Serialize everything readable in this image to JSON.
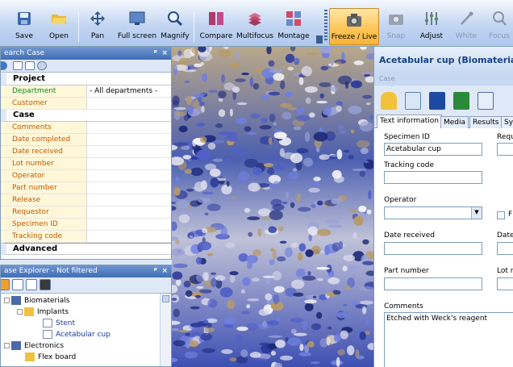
{
  "toolbar": {
    "save": "Save",
    "open": "Open",
    "pan": "Pan",
    "fullscreen": "Full screen",
    "magnify": "Magnify",
    "compare": "Compare",
    "multifocus": "Multifocus",
    "montage": "Montage",
    "freeze_live": "Freeze / Live",
    "snap": "Snap",
    "adjust": "Adjust",
    "white": "White",
    "focus": "Focus"
  },
  "search_panel": {
    "title": "earch Case",
    "pin": "⁵",
    "close": "×",
    "sections": {
      "project": "Project",
      "case": "Case",
      "advanced": "Advanced"
    },
    "project_rows": [
      {
        "key": "Department",
        "value": "- All departments -"
      },
      {
        "key": "Customer",
        "value": ""
      }
    ],
    "case_rows": [
      {
        "key": "Comments",
        "value": ""
      },
      {
        "key": "Date completed",
        "value": ""
      },
      {
        "key": "Date received",
        "value": ""
      },
      {
        "key": "Lot number",
        "value": ""
      },
      {
        "key": "Operator",
        "value": ""
      },
      {
        "key": "Part number",
        "value": ""
      },
      {
        "key": "Release",
        "value": ""
      },
      {
        "key": "Requestor",
        "value": ""
      },
      {
        "key": "Specimen ID",
        "value": ""
      },
      {
        "key": "Tracking code",
        "value": ""
      }
    ]
  },
  "explorer_panel": {
    "title": "ase Explorer - Not filtered",
    "pin": "⁵",
    "close": "×",
    "items": [
      {
        "label": "Biomaterials"
      },
      {
        "label": "Implants"
      },
      {
        "label": "Stent"
      },
      {
        "label": "Acetabular cup"
      },
      {
        "label": "Electronics"
      },
      {
        "label": "Flex board"
      }
    ]
  },
  "detail_panel": {
    "title": "Acetabular cup (Biomaterials / I",
    "subtitle": "Case",
    "tabs": [
      "Text information",
      "Media",
      "Results",
      "Sy"
    ],
    "fields": {
      "specimen_id_label": "Specimen ID",
      "specimen_id_value": "Acetabular cup",
      "requ_label": "Requ",
      "tracking_code_label": "Tracking code",
      "tracking_code_value": "",
      "operator_label": "Operator",
      "operator_value": "",
      "release_cb_label": "F",
      "date_received_label": "Date received",
      "date_label": "Date",
      "part_number_label": "Part number",
      "lot_label": "Lot n",
      "comments_label": "Comments",
      "comments_value": "Etched with Weck's reagent"
    }
  },
  "colors": {
    "toolbar_top": "#f4f8fe",
    "toolbar_bottom": "#b0c8ee",
    "active_tool": "#ffca5e",
    "panel_title": "#3f6db8",
    "key_bg": "#fff7d9",
    "key_text": "#c05a00",
    "detail_title": "#15428b"
  }
}
